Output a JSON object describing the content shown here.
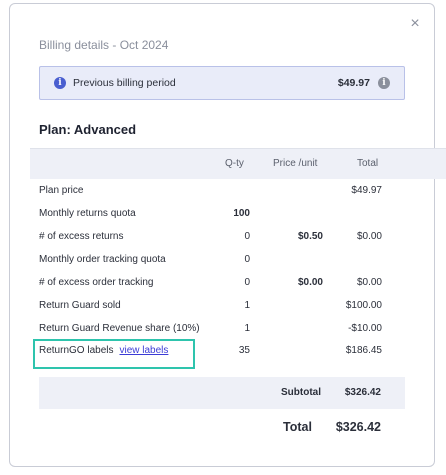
{
  "modal": {
    "title": "Billing details - Oct 2024",
    "close_icon": "×",
    "notice": {
      "icon": "info-icon",
      "label": "Previous billing period",
      "amount": "$49.97",
      "trailing_icon": "info-icon"
    },
    "plan_title": "Plan: Advanced",
    "columns": {
      "qty": "Q-ty",
      "price": "Price /unit",
      "total": "Total"
    },
    "rows": [
      {
        "name": "Plan price",
        "qty": "",
        "price": "",
        "total": "$49.97"
      },
      {
        "name": "Monthly returns quota",
        "qty": "100",
        "price": "",
        "total": ""
      },
      {
        "name": "# of excess returns",
        "qty": "0",
        "price": "$0.50",
        "total": "$0.00"
      },
      {
        "name": "Monthly order tracking quota",
        "qty": "0",
        "price": "",
        "total": ""
      },
      {
        "name": "# of excess order tracking",
        "qty": "0",
        "price": "$0.00",
        "total": "$0.00"
      },
      {
        "name": "Return Guard sold",
        "qty": "1",
        "price": "",
        "total": "$100.00"
      },
      {
        "name": "Return Guard Revenue share (10%)",
        "qty": "1",
        "price": "",
        "total": "-$10.00"
      },
      {
        "name": "ReturnGO labels",
        "link": "view labels",
        "qty": "35",
        "price": "",
        "total": "$186.45"
      }
    ],
    "subtotal_label": "Subtotal",
    "subtotal_value": "$326.42",
    "total_label": "Total",
    "total_value": "$326.42"
  }
}
